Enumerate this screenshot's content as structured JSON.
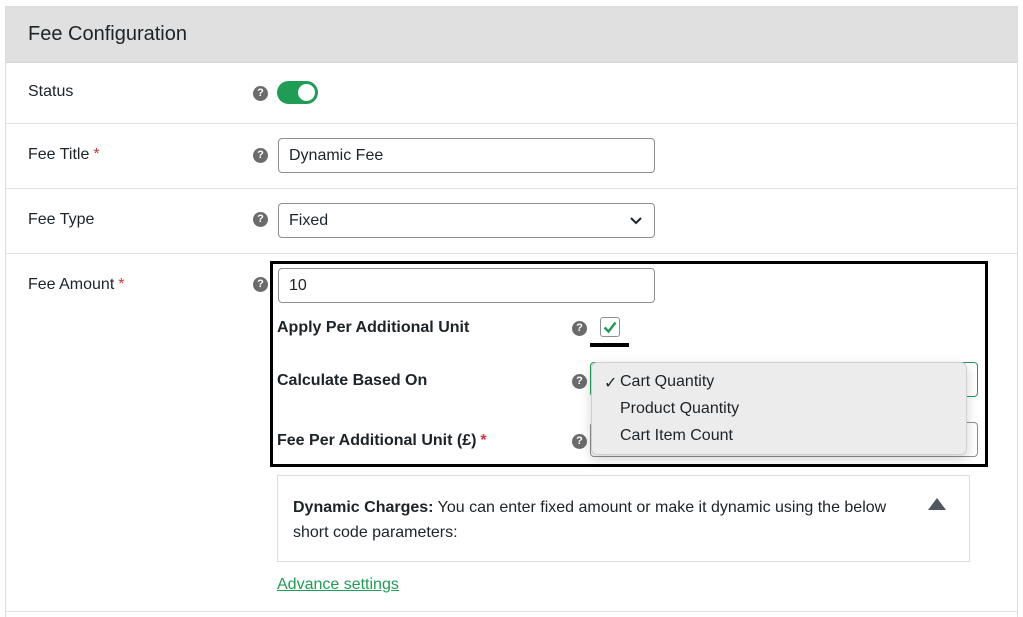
{
  "panel": {
    "title": "Fee Configuration"
  },
  "rows": {
    "status": {
      "label": "Status",
      "toggle_on": true
    },
    "fee_title": {
      "label": "Fee Title",
      "required": "*",
      "value": "Dynamic Fee"
    },
    "fee_type": {
      "label": "Fee Type",
      "value": "Fixed"
    },
    "fee_amount": {
      "label": "Fee Amount",
      "required": "*",
      "value": "10"
    }
  },
  "per_unit": {
    "apply_label": "Apply Per Additional Unit",
    "apply_checked": true,
    "calculate_label": "Calculate Based On",
    "fee_per_unit_label": "Fee Per Additional Unit (£)",
    "required": "*"
  },
  "dropdown": {
    "check_mark": "✓",
    "options": [
      "Cart Quantity",
      "Product Quantity",
      "Cart Item Count"
    ],
    "selected": "Cart Quantity"
  },
  "notice": {
    "strong": "Dynamic Charges:",
    "text": " You can enter fixed amount or make it dynamic using the below short code parameters:"
  },
  "links": {
    "advance_settings": "Advance settings"
  },
  "icons": {
    "help": "?",
    "help_icon": "question-circle-icon",
    "chevron": "chevron-down-icon",
    "collapse": "triangle-up-icon"
  },
  "colors": {
    "accent": "#1f9d55",
    "required": "#d63638",
    "header_bg": "#e0e0e0"
  }
}
